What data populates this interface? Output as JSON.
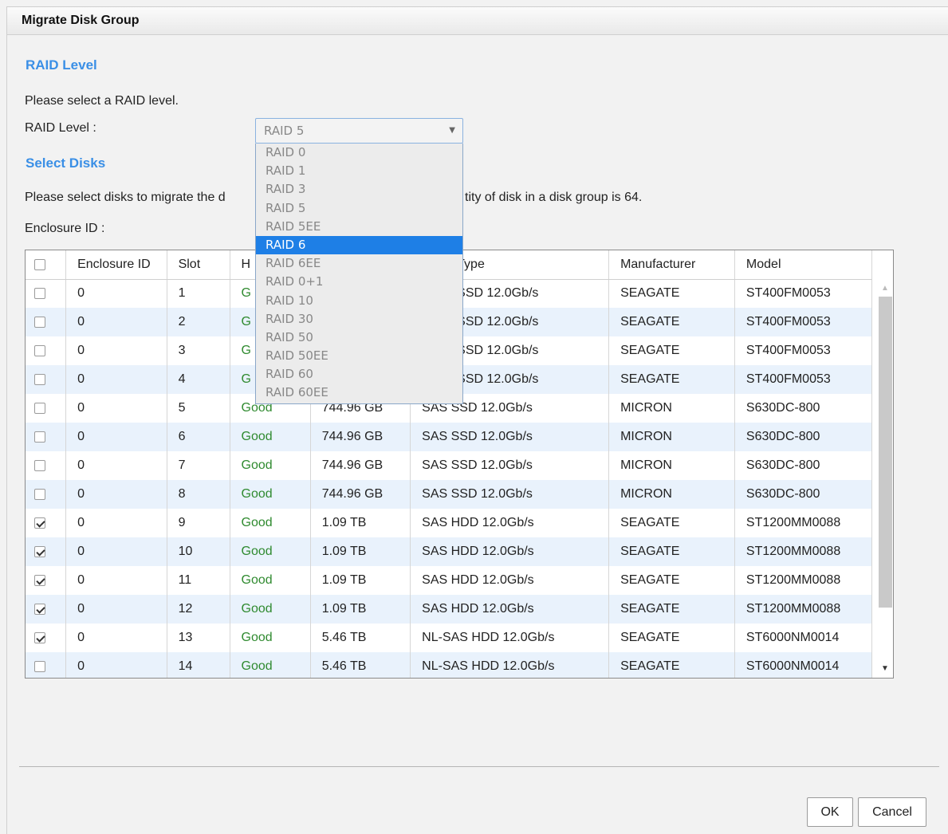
{
  "dialog": {
    "title": "Migrate Disk Group"
  },
  "raid_section": {
    "heading": "RAID Level",
    "instruction": "Please select a RAID level.",
    "field_label": "RAID Level :",
    "selected_value": "RAID 5",
    "highlighted_option": "RAID 6",
    "options": [
      "RAID 0",
      "RAID 1",
      "RAID 3",
      "RAID 5",
      "RAID 5EE",
      "RAID 6",
      "RAID 6EE",
      "RAID 0+1",
      "RAID 10",
      "RAID 30",
      "RAID 50",
      "RAID 50EE",
      "RAID 60",
      "RAID 60EE"
    ]
  },
  "disks_section": {
    "heading": "Select Disks",
    "instruction_left": "Please select disks to migrate the d",
    "instruction_right": "tity of disk in a disk group is 64.",
    "enclosure_label": "Enclosure ID :"
  },
  "table": {
    "columns": [
      "Enclosure ID",
      "Slot",
      "H",
      "Type",
      "Manufacturer",
      "Model"
    ],
    "rows": [
      {
        "checked": false,
        "enclosure": "0",
        "slot": "1",
        "health": "G",
        "size": "",
        "type": "SSD 12.0Gb/s",
        "manufacturer": "SEAGATE",
        "model": "ST400FM0053"
      },
      {
        "checked": false,
        "enclosure": "0",
        "slot": "2",
        "health": "G",
        "size": "",
        "type": "SSD 12.0Gb/s",
        "manufacturer": "SEAGATE",
        "model": "ST400FM0053"
      },
      {
        "checked": false,
        "enclosure": "0",
        "slot": "3",
        "health": "G",
        "size": "",
        "type": "SSD 12.0Gb/s",
        "manufacturer": "SEAGATE",
        "model": "ST400FM0053"
      },
      {
        "checked": false,
        "enclosure": "0",
        "slot": "4",
        "health": "G",
        "size": "",
        "type": "SSD 12.0Gb/s",
        "manufacturer": "SEAGATE",
        "model": "ST400FM0053"
      },
      {
        "checked": false,
        "enclosure": "0",
        "slot": "5",
        "health": "Good",
        "size": "744.96 GB",
        "type": "SAS SSD 12.0Gb/s",
        "manufacturer": "MICRON",
        "model": "S630DC-800"
      },
      {
        "checked": false,
        "enclosure": "0",
        "slot": "6",
        "health": "Good",
        "size": "744.96 GB",
        "type": "SAS SSD 12.0Gb/s",
        "manufacturer": "MICRON",
        "model": "S630DC-800"
      },
      {
        "checked": false,
        "enclosure": "0",
        "slot": "7",
        "health": "Good",
        "size": "744.96 GB",
        "type": "SAS SSD 12.0Gb/s",
        "manufacturer": "MICRON",
        "model": "S630DC-800"
      },
      {
        "checked": false,
        "enclosure": "0",
        "slot": "8",
        "health": "Good",
        "size": "744.96 GB",
        "type": "SAS SSD 12.0Gb/s",
        "manufacturer": "MICRON",
        "model": "S630DC-800"
      },
      {
        "checked": true,
        "enclosure": "0",
        "slot": "9",
        "health": "Good",
        "size": "1.09 TB",
        "type": "SAS HDD 12.0Gb/s",
        "manufacturer": "SEAGATE",
        "model": "ST1200MM0088"
      },
      {
        "checked": true,
        "enclosure": "0",
        "slot": "10",
        "health": "Good",
        "size": "1.09 TB",
        "type": "SAS HDD 12.0Gb/s",
        "manufacturer": "SEAGATE",
        "model": "ST1200MM0088"
      },
      {
        "checked": true,
        "enclosure": "0",
        "slot": "11",
        "health": "Good",
        "size": "1.09 TB",
        "type": "SAS HDD 12.0Gb/s",
        "manufacturer": "SEAGATE",
        "model": "ST1200MM0088"
      },
      {
        "checked": true,
        "enclosure": "0",
        "slot": "12",
        "health": "Good",
        "size": "1.09 TB",
        "type": "SAS HDD 12.0Gb/s",
        "manufacturer": "SEAGATE",
        "model": "ST1200MM0088"
      },
      {
        "checked": true,
        "enclosure": "0",
        "slot": "13",
        "health": "Good",
        "size": "5.46 TB",
        "type": "NL-SAS HDD 12.0Gb/s",
        "manufacturer": "SEAGATE",
        "model": "ST6000NM0014"
      },
      {
        "checked": false,
        "enclosure": "0",
        "slot": "14",
        "health": "Good",
        "size": "5.46 TB",
        "type": "NL-SAS HDD 12.0Gb/s",
        "manufacturer": "SEAGATE",
        "model": "ST6000NM0014"
      }
    ]
  },
  "buttons": {
    "ok": "OK",
    "cancel": "Cancel"
  },
  "colors": {
    "accent": "#3a8fe6",
    "good": "#2f8a2f",
    "selected_option": "#1e7fe6"
  }
}
